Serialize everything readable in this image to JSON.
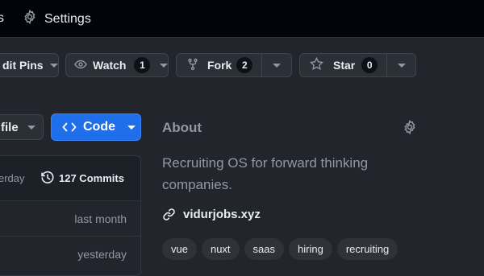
{
  "topnav": {
    "fragment_label": "s",
    "settings_label": "Settings",
    "settings_icon": "gear-icon"
  },
  "actions": {
    "edit_pins": {
      "label": "dit Pins"
    },
    "watch": {
      "label": "Watch",
      "count": "1"
    },
    "fork": {
      "label": "Fork",
      "count": "2"
    },
    "star": {
      "label": "Star",
      "count": "0"
    }
  },
  "files": {
    "go_to_file_label": "file",
    "code_label": "Code",
    "commits_label": "127 Commits",
    "latest_commit_time": "erday",
    "rows": [
      {
        "time": "last month"
      },
      {
        "time": "yesterday"
      }
    ]
  },
  "about": {
    "title": "About",
    "description": "Recruiting OS for forward thinking companies.",
    "website": "vidurjobs.xyz",
    "topics": [
      "vue",
      "nuxt",
      "saas",
      "hiring",
      "recruiting"
    ]
  },
  "colors": {
    "topbar_bg": "#010409",
    "page_bg": "#22262c",
    "button_bg": "#2b3037",
    "primary_blue": "#1f6feb",
    "muted_text": "#9198a1"
  }
}
